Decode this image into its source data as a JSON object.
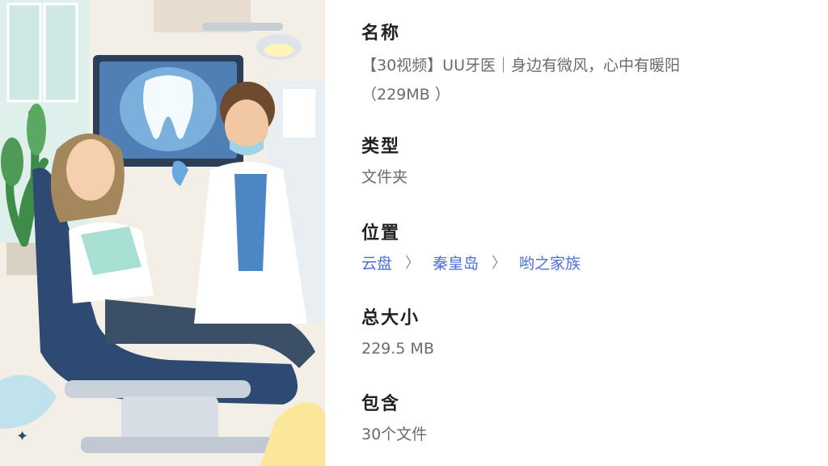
{
  "details": {
    "name": {
      "label": "名称",
      "value_line1": "【30视频】UU牙医｜身边有微风，心中有暖阳",
      "value_line2": "（229MB ）"
    },
    "type": {
      "label": "类型",
      "value": "文件夹"
    },
    "location": {
      "label": "位置",
      "path": [
        "云盘",
        "秦皇岛",
        "哟之家族"
      ]
    },
    "size": {
      "label": "总大小",
      "value": "229.5 MB"
    },
    "contains": {
      "label": "包含",
      "value": "30个文件"
    }
  },
  "icons": {
    "path_separator": "chevron-right-icon"
  },
  "colors": {
    "link": "#4a6fd6",
    "label": "#222222",
    "value": "#6b6b6b"
  }
}
